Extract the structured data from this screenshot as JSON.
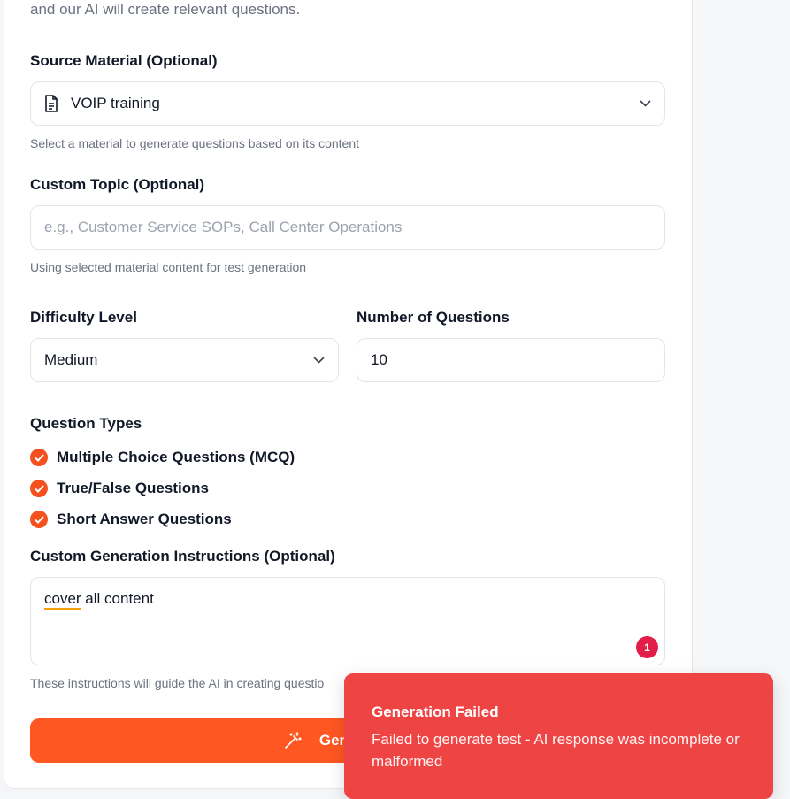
{
  "intro": "and our AI will create relevant questions.",
  "source": {
    "label": "Source Material (Optional)",
    "value": "VOIP training",
    "hint": "Select a material to generate questions based on its content"
  },
  "topic": {
    "label": "Custom Topic (Optional)",
    "placeholder": "e.g., Customer Service SOPs, Call Center Operations",
    "hint": "Using selected material content for test generation"
  },
  "difficulty": {
    "label": "Difficulty Level",
    "value": "Medium"
  },
  "num_questions": {
    "label": "Number of Questions",
    "value": "10"
  },
  "question_types": {
    "label": "Question Types",
    "items": [
      {
        "label": "Multiple Choice Questions (MCQ)",
        "checked": true
      },
      {
        "label": "True/False Questions",
        "checked": true
      },
      {
        "label": "Short Answer Questions",
        "checked": true
      }
    ]
  },
  "instructions": {
    "label": "Custom Generation Instructions (Optional)",
    "value_word1": "cover",
    "value_rest": " all content",
    "badge": "1",
    "hint": "These instructions will guide the AI in creating questio"
  },
  "generate_button": {
    "label": "Generat"
  },
  "toast": {
    "title": "Generation Failed",
    "message": "Failed to generate test - AI response was incomplete or malformed"
  },
  "colors": {
    "accent": "#ff5722",
    "check": "#f4511e",
    "toast": "#ef4444",
    "badge": "#e11d48"
  }
}
